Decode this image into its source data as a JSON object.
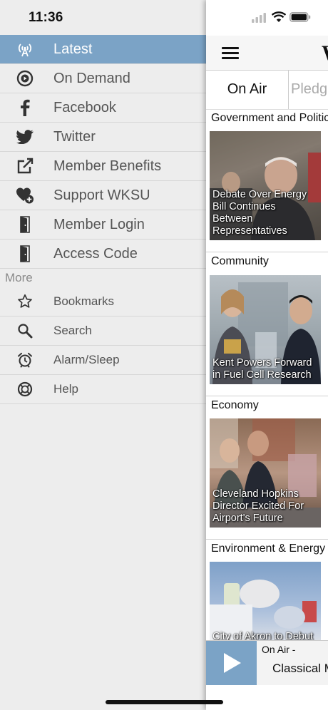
{
  "status_bar": {
    "time": "11:36"
  },
  "drawer": {
    "items": [
      {
        "label": "Latest",
        "icon": "broadcast-tower-icon",
        "selected": true
      },
      {
        "label": "On Demand",
        "icon": "play-circle-icon"
      },
      {
        "label": "Facebook",
        "icon": "facebook-icon"
      },
      {
        "label": "Twitter",
        "icon": "twitter-icon"
      },
      {
        "label": "Member Benefits",
        "icon": "external-link-icon"
      },
      {
        "label": "Support WKSU",
        "icon": "heart-plus-icon"
      },
      {
        "label": "Member Login",
        "icon": "door-icon"
      },
      {
        "label": "Access Code",
        "icon": "door-icon"
      }
    ],
    "more_label": "More",
    "more_items": [
      {
        "label": "Bookmarks",
        "icon": "star-icon"
      },
      {
        "label": "Search",
        "icon": "search-icon"
      },
      {
        "label": "Alarm/Sleep",
        "icon": "alarm-clock-icon"
      },
      {
        "label": "Help",
        "icon": "help-icon"
      }
    ]
  },
  "main": {
    "logo_text": "W",
    "tabs": {
      "on_air": "On Air",
      "pledge": "Pledge"
    },
    "categories": [
      {
        "title": "Government and Politics",
        "caption": "Debate Over Energy Bill Continues Between Representatives"
      },
      {
        "title": "Community",
        "caption": "Kent Powers Forward in Fuel Cell Research"
      },
      {
        "title": "Economy",
        "caption": "Cleveland Hopkins Director Excited For Airport's Future"
      },
      {
        "title": "Environment & Energy",
        "caption": "City of Akron to Debut"
      }
    ],
    "player": {
      "status": "On Air -",
      "program": "Classical M"
    }
  },
  "colors": {
    "accent": "#7ba3c6"
  }
}
